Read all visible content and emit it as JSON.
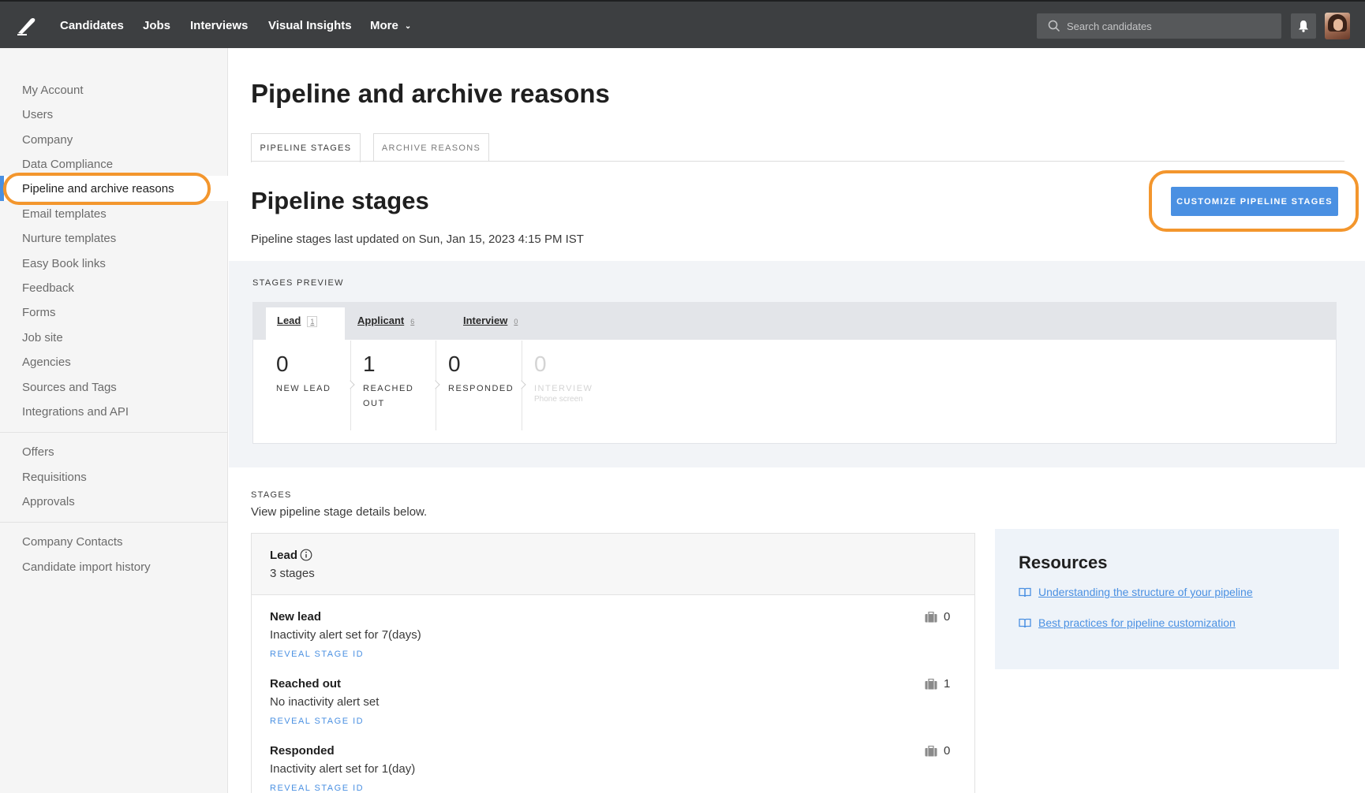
{
  "nav": {
    "items": [
      "Candidates",
      "Jobs",
      "Interviews",
      "Visual Insights",
      "More"
    ],
    "search_placeholder": "Search candidates"
  },
  "sidebar": {
    "group1": [
      "My Account",
      "Users",
      "Company",
      "Data Compliance",
      "Pipeline and archive reasons",
      "Email templates",
      "Nurture templates",
      "Easy Book links",
      "Feedback",
      "Forms",
      "Job site",
      "Agencies",
      "Sources and Tags",
      "Integrations and API"
    ],
    "group2": [
      "Offers",
      "Requisitions",
      "Approvals"
    ],
    "group3": [
      "Company Contacts",
      "Candidate import history"
    ],
    "active": "Pipeline and archive reasons"
  },
  "page": {
    "title": "Pipeline and archive reasons",
    "tabs": [
      "PIPELINE STAGES",
      "ARCHIVE REASONS"
    ],
    "active_tab": "PIPELINE STAGES"
  },
  "pipeline": {
    "title": "Pipeline stages",
    "updated": "Pipeline stages last updated on Sun, Jan 15, 2023 4:15 PM IST",
    "customize_label": "CUSTOMIZE PIPELINE STAGES"
  },
  "preview": {
    "label": "STAGES PREVIEW",
    "tabs": [
      {
        "label": "Lead",
        "count": "1"
      },
      {
        "label": "Applicant",
        "count": "6"
      },
      {
        "label": "Interview",
        "count": "0"
      }
    ],
    "stages": [
      {
        "count": "0",
        "name": "NEW LEAD"
      },
      {
        "count": "1",
        "name": "REACHED OUT"
      },
      {
        "count": "0",
        "name": "RESPONDED"
      },
      {
        "count": "0",
        "name": "INTERVIEW",
        "sub": "Phone screen"
      }
    ]
  },
  "stages": {
    "label": "STAGES",
    "description": "View pipeline stage details below.",
    "group": {
      "name": "Lead",
      "count": "3 stages"
    },
    "rows": [
      {
        "name": "New lead",
        "alert": "Inactivity alert set for 7(days)",
        "reveal": "REVEAL STAGE ID",
        "count": "0"
      },
      {
        "name": "Reached out",
        "alert": "No inactivity alert set",
        "reveal": "REVEAL STAGE ID",
        "count": "1"
      },
      {
        "name": "Responded",
        "alert": "Inactivity alert set for 1(day)",
        "reveal": "REVEAL STAGE ID",
        "count": "0"
      }
    ]
  },
  "resources": {
    "title": "Resources",
    "links": [
      "Understanding the structure of your pipeline",
      "Best practices for pipeline customization"
    ]
  },
  "colors": {
    "accent": "#4a90e2",
    "highlight": "#f3962d",
    "nav_bg": "#3d3f41"
  }
}
